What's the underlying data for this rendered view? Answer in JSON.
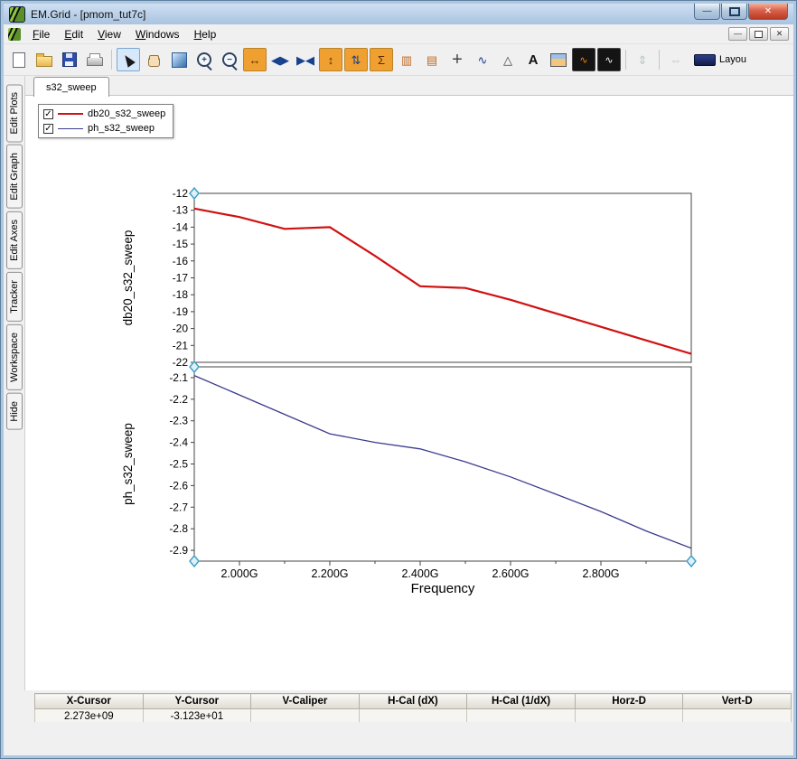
{
  "window": {
    "title": "EM.Grid - [pmom_tut7c]",
    "controls": [
      {
        "name": "minimize-button",
        "glyph": "—"
      },
      {
        "name": "maximize-button",
        "glyph": "box"
      },
      {
        "name": "close-button",
        "glyph": "✕"
      }
    ]
  },
  "menu": {
    "items": [
      {
        "label": "File"
      },
      {
        "label": "Edit"
      },
      {
        "label": "View"
      },
      {
        "label": "Windows"
      },
      {
        "label": "Help"
      }
    ],
    "mdi_controls": [
      {
        "name": "mdi-minimize-button",
        "glyph": "—"
      },
      {
        "name": "mdi-restore-button",
        "glyph": "box"
      },
      {
        "name": "mdi-close-button",
        "glyph": "✕"
      }
    ]
  },
  "toolbar": {
    "items": [
      {
        "name": "new-document-icon",
        "kind": "page"
      },
      {
        "name": "open-folder-icon",
        "kind": "folder"
      },
      {
        "name": "save-icon",
        "kind": "floppy"
      },
      {
        "name": "print-icon",
        "kind": "printer"
      },
      {
        "type": "sep"
      },
      {
        "name": "select-arrow-icon",
        "kind": "cursor",
        "state": "active"
      },
      {
        "name": "pan-hand-icon",
        "kind": "hand"
      },
      {
        "name": "zoom-window-icon",
        "kind": "zoomwin"
      },
      {
        "name": "zoom-in-icon",
        "kind": "zoom",
        "glyph": "+"
      },
      {
        "name": "zoom-out-icon",
        "kind": "zoom",
        "glyph": "−"
      },
      {
        "name": "expand-x-icon",
        "kind": "glyph",
        "glyph": "↔",
        "fg": "#5a2d00",
        "bg": "#f0a030"
      },
      {
        "name": "scroll-x-icon",
        "kind": "glyph",
        "glyph": "◀▶",
        "fg": "#15418f"
      },
      {
        "name": "compress-x-icon",
        "kind": "glyph",
        "glyph": "▶◀",
        "fg": "#15418f"
      },
      {
        "name": "expand-y-icon",
        "kind": "glyph",
        "glyph": "↕",
        "fg": "#5a2d00",
        "bg": "#f0a030"
      },
      {
        "name": "scroll-y-icon",
        "kind": "glyph",
        "glyph": "⇅",
        "fg": "#15418f",
        "bg": "#f0a030"
      },
      {
        "name": "autoscale-sum-icon",
        "kind": "glyph",
        "glyph": "Σ",
        "fg": "#5a2d00",
        "bg": "#f0a030"
      },
      {
        "name": "table-columns-icon",
        "kind": "glyph",
        "glyph": "▥",
        "fg": "#c06820"
      },
      {
        "name": "table-rows-icon",
        "kind": "glyph",
        "glyph": "▤",
        "fg": "#c06820"
      },
      {
        "name": "add-marker-icon",
        "kind": "glyph",
        "glyph": "+",
        "fg": "#444444",
        "big": true
      },
      {
        "name": "curve-marker-icon",
        "kind": "glyph",
        "glyph": "∿",
        "fg": "#15418f"
      },
      {
        "name": "slope-marker-icon",
        "kind": "glyph",
        "glyph": "△",
        "fg": "#444444"
      },
      {
        "name": "text-annotation-icon",
        "kind": "glyph",
        "glyph": "A",
        "fg": "#111111",
        "bold": true
      },
      {
        "name": "image-icon",
        "kind": "picture"
      },
      {
        "name": "fft-window1-icon",
        "kind": "wave",
        "glyph": "∿",
        "fg": "#ff8800"
      },
      {
        "name": "fft-window2-icon",
        "kind": "wave",
        "glyph": "∿",
        "fg": "#ffffff"
      },
      {
        "type": "sep"
      },
      {
        "name": "fit-vertical-disabled-icon",
        "kind": "glyph",
        "glyph": "⇕",
        "fg": "#7a937a",
        "state": "disabled"
      },
      {
        "type": "sep"
      },
      {
        "name": "fit-horizontal-disabled-icon",
        "kind": "glyph",
        "glyph": "⇔",
        "fg": "#7a937a",
        "state": "disabled"
      },
      {
        "name": "layout-button",
        "kind": "layout",
        "label": "Layou"
      }
    ]
  },
  "sidebar": {
    "tabs": [
      "Edit Plots",
      "Edit Graph",
      "Edit Axes",
      "Tracker",
      "Workspace",
      "Hide"
    ]
  },
  "tabs": {
    "active": "s32_sweep"
  },
  "legend": {
    "entries": [
      {
        "label": "db20_s32_sweep",
        "color": "#d11111",
        "checked": true
      },
      {
        "label": "ph_s32_sweep",
        "color": "#3b3b8e",
        "checked": true
      }
    ]
  },
  "chart_data": [
    {
      "type": "line",
      "name": "db20_s32_sweep",
      "ylabel": "db20_s32_sweep",
      "color": "#d11111",
      "x": [
        1.9,
        2.0,
        2.1,
        2.2,
        2.3,
        2.4,
        2.5,
        2.6,
        2.7,
        2.8,
        2.9,
        3.0
      ],
      "y": [
        -12.9,
        -13.4,
        -14.1,
        -14.0,
        -15.7,
        -17.5,
        -17.6,
        -18.3,
        -19.1,
        -19.9,
        -20.7,
        -21.5
      ],
      "xlim": [
        1.9,
        3.0
      ],
      "ylim": [
        -22,
        -12
      ],
      "yticks": [
        -12,
        -13,
        -14,
        -15,
        -16,
        -17,
        -18,
        -19,
        -20,
        -21,
        -22
      ],
      "ytick_decimals": 0,
      "grid": false,
      "legend_position": "top-left"
    },
    {
      "type": "line",
      "name": "ph_s32_sweep",
      "ylabel": "ph_s32_sweep",
      "xlabel": "Frequency",
      "color": "#3b3b8e",
      "x": [
        1.9,
        2.0,
        2.1,
        2.2,
        2.3,
        2.4,
        2.5,
        2.6,
        2.7,
        2.8,
        2.9,
        3.0
      ],
      "y": [
        -2.09,
        -2.18,
        -2.27,
        -2.36,
        -2.4,
        -2.43,
        -2.49,
        -2.56,
        -2.64,
        -2.72,
        -2.81,
        -2.89
      ],
      "xlim": [
        1.9,
        3.0
      ],
      "ylim": [
        -2.95,
        -2.05
      ],
      "yticks": [
        -2.1,
        -2.2,
        -2.3,
        -2.4,
        -2.5,
        -2.6,
        -2.7,
        -2.8,
        -2.9
      ],
      "ytick_decimals": 1,
      "xticks": [
        2.0,
        2.2,
        2.4,
        2.6,
        2.8
      ],
      "xtick_labels": [
        "2.000G",
        "2.200G",
        "2.400G",
        "2.600G",
        "2.800G"
      ],
      "grid": false
    }
  ],
  "cursor_table": {
    "headers": [
      "X-Cursor",
      "Y-Cursor",
      "V-Caliper",
      "H-Cal (dX)",
      "H-Cal (1/dX)",
      "Horz-D",
      "Vert-D"
    ],
    "values": [
      "2.273e+09",
      "-3.123e+01",
      "",
      "",
      "",
      "",
      ""
    ]
  }
}
